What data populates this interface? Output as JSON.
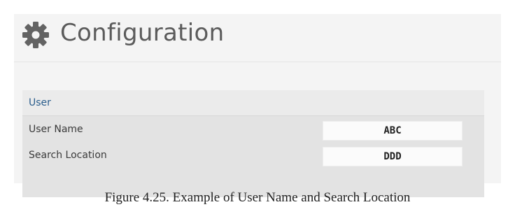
{
  "header": {
    "icon": "gear-icon",
    "title": "Configuration"
  },
  "user_section": {
    "title": "User",
    "rows": [
      {
        "label": "User Name",
        "value": "ABC"
      },
      {
        "label": "Search Location",
        "value": "DDD"
      }
    ]
  },
  "caption": "Figure 4.25. Example of User Name and Search Location",
  "colors": {
    "panel_background": "#f4f4f4",
    "section_title": "#2a5d8c",
    "title_text": "#5b5b5b",
    "gear_icon": "#636363"
  }
}
